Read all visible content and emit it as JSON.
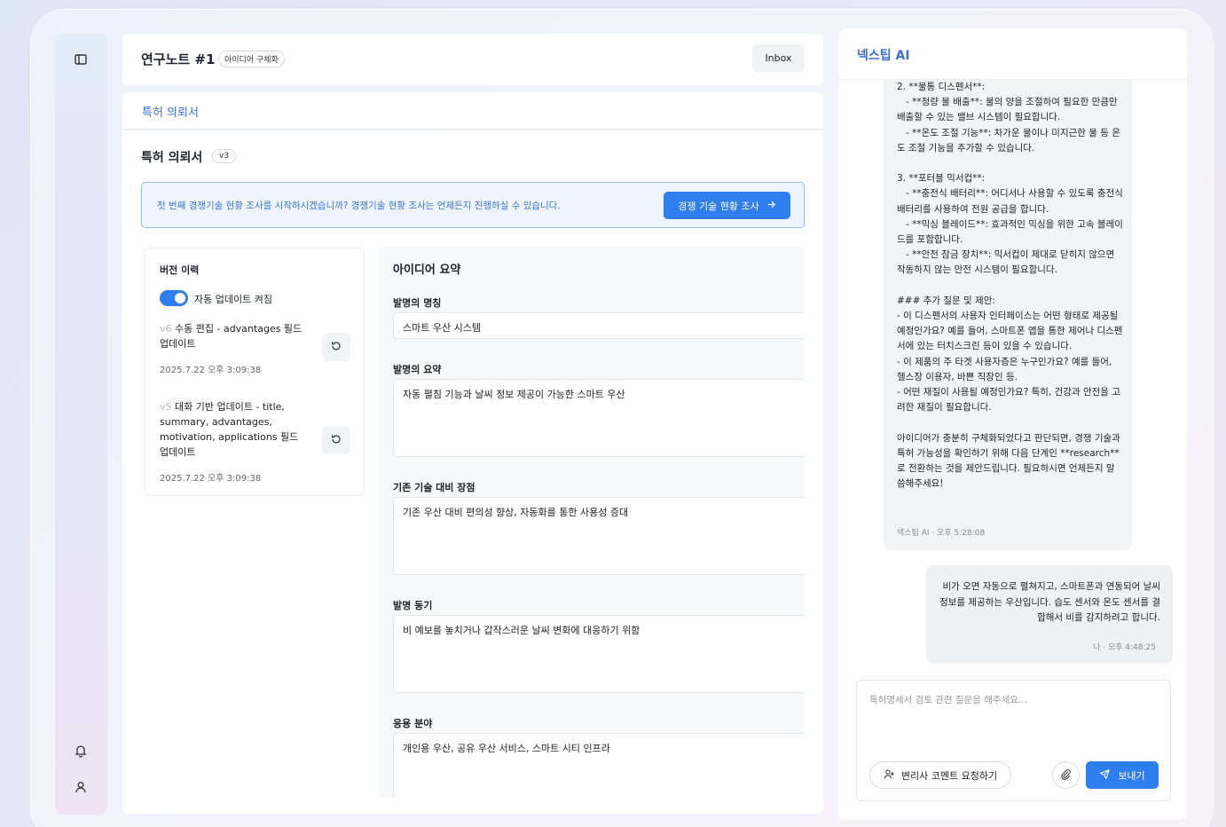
{
  "header": {
    "title": "연구노트 #1",
    "badge": "아이디어 구체화",
    "inbox_label": "Inbox"
  },
  "tabs": [
    {
      "label": "특허 의뢰서"
    }
  ],
  "section": {
    "title": "특허 의뢰서",
    "version_badge": "v3"
  },
  "notice": {
    "text": "첫 번째 경쟁기술 현황 조사를 시작하시겠습니까? 경쟁기술 현황 조사는 언제든지 진행하실 수 있습니다.",
    "button_label": "경쟁 기술 현황 조사"
  },
  "history": {
    "title": "버전 이력",
    "auto_update_label": "자동 업데이트 켜짐",
    "auto_update_on": true,
    "versions": [
      {
        "version": "v6",
        "desc": "수동 편집 - advantages 필드 업데이트",
        "time": "2025.7.22 오후 3:09:38"
      },
      {
        "version": "v5",
        "desc": "대화 기반 업데이트 - title, summary, advantages, motivation, applications 필드 업데이트",
        "time": "2025.7.22 오후 3:09:38"
      }
    ]
  },
  "summary": {
    "title": "아이디어 요약",
    "fields": [
      {
        "label": "발명의 명칭",
        "value": "스마트 우산 시스템"
      },
      {
        "label": "발명의 요약",
        "value": "자동 펼침 기능과 날씨 정보 제공이 가능한 스마트 우산"
      },
      {
        "label": "기존 기술 대비 장점",
        "value": "기존 우산 대비 편의성 향상, 자동화를 통한 사용성 증대"
      },
      {
        "label": "발명 동기",
        "value": "비 예보를 놓치거나 갑작스러운 날씨 변화에 대응하기 위함"
      },
      {
        "label": "응용 분야",
        "value": "개인용 우산, 공유 우산 서비스, 스마트 시티 인프라"
      }
    ]
  },
  "chat": {
    "title": "넥스팁 AI",
    "ai_message": "2. **물통 디스펜서**:\n   - **정량 물 배출**: 물의 양을 조절하여 필요한 만큼만 배출할 수 있는 밸브 시스템이 필요합니다.\n   - **온도 조절 기능**: 차가운 물이나 미지근한 물 등 온도 조절 기능을 추가할 수 있습니다.\n\n3. **포터블 믹서컵**:\n   - **충전식 배터리**: 어디서나 사용할 수 있도록 충전식 배터리를 사용하여 전원 공급을 합니다.\n   - **믹싱 블레이드**: 효과적인 믹싱을 위한 고속 블레이드를 포함합니다.\n   - **안전 잠금 장치**: 믹서컵이 제대로 닫히지 않으면 작동하지 않는 안전 시스템이 필요합니다.\n\n### 추가 질문 및 제안:\n- 이 디스펜서의 사용자 인터페이스는 어떤 형태로 제공될 예정인가요? 예를 들어, 스마트폰 앱을 통한 제어나 디스펜서에 있는 터치스크린 등이 있을 수 있습니다.\n- 이 제품의 주 타겟 사용자층은 누구인가요? 예를 들어, 헬스장 이용자, 바쁜 직장인 등.\n- 어떤 재질이 사용될 예정인가요? 특히, 건강과 안전을 고려한 재질이 필요합니다.\n\n아이디어가 충분히 구체화되었다고 판단되면, 경쟁 기술과 특허 가능성을 확인하기 위해 다음 단계인 **research**로 전환하는 것을 제안드립니다. 필요하시면 언제든지 말씀해주세요!",
    "ai_meta": "넥스팁 AI · 오후 5:28:08",
    "user_message": "비가 오면 자동으로 펼쳐지고, 스마트폰과 연동되어 날씨 정보를 제공하는 우산입니다. 습도 센서와 온도 센서를 결합해서 비를 감지하려고 합니다.",
    "user_meta": "나 · 오후 4:48:25",
    "input_placeholder": "특허명세서 검토 관련 질문을 해주세요...",
    "attorney_button_label": "변리사 코멘트 요청하기",
    "send_label": "보내기"
  },
  "colors": {
    "accent": "#2f7ef0",
    "link": "#3b74d6"
  }
}
